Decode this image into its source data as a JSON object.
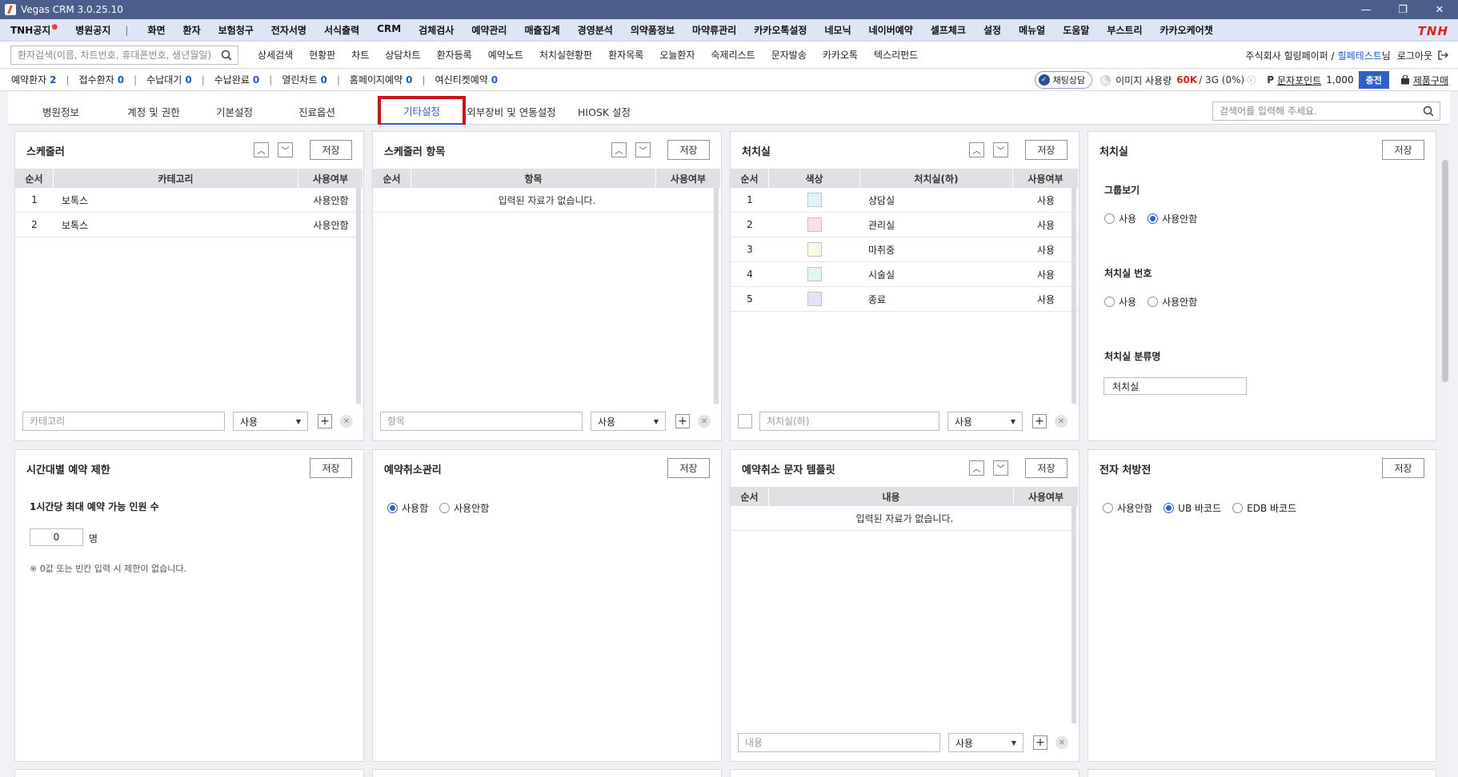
{
  "window": {
    "title": "Vegas CRM 3.0.25.10",
    "minimize": "—",
    "maximize": "❐",
    "close": "✕"
  },
  "menu": {
    "notice": "TNH공지",
    "notice_dot": "●",
    "hospital_notice": "병원공지",
    "sep": "|",
    "items": [
      "화면",
      "환자",
      "보험청구",
      "전자서명",
      "서식출력",
      "CRM",
      "검체검사",
      "예약관리",
      "매출집계",
      "경영분석",
      "의약품정보",
      "마약류관리",
      "카카오톡설정",
      "네모닉",
      "네이버예약",
      "셀프체크",
      "설정",
      "메뉴얼",
      "도움말",
      "부스트리",
      "카카오케어챗"
    ],
    "brand": "TNH"
  },
  "subbar": {
    "search_placeholder": "환자검색(이름, 차트번호, 휴대폰번호, 생년월일)",
    "links": [
      "상세검색",
      "현황판",
      "차트",
      "상담차트",
      "환자등록",
      "예약노트",
      "처치실현황판",
      "환자목록",
      "오늘환자",
      "숙제리스트",
      "문자발송",
      "카카오톡",
      "텍스리펀드"
    ],
    "company": "주식회사 힐링페이퍼 /",
    "user": "힐페테스트",
    "user_suffix": "님",
    "logout": "로그아웃"
  },
  "status": {
    "items": [
      {
        "label": "예약환자",
        "count": "2"
      },
      {
        "label": "접수환자",
        "count": "0"
      },
      {
        "label": "수납대기",
        "count": "0"
      },
      {
        "label": "수납완료",
        "count": "0"
      },
      {
        "label": "열린차트",
        "count": "0"
      },
      {
        "label": "홈페이지예약",
        "count": "0"
      },
      {
        "label": "여신티켓예약",
        "count": "0"
      }
    ],
    "chat": "채팅상담",
    "image_usage_label": "이미지 사용량",
    "image_usage_value": "60K",
    "image_usage_tail": "/ 3G (0%)",
    "point_label": "문자포인트",
    "point_value": "1,000",
    "charge": "충전",
    "buy": "제품구매"
  },
  "tabs": {
    "items": [
      "병원정보",
      "계정 및 권한",
      "기본설정",
      "진료옵션",
      "기타설정",
      "외부장비 및 연동설정",
      "HIOSK 설정"
    ],
    "active": "기타설정",
    "search_placeholder": "검색어를 입력해 주세요."
  },
  "common": {
    "save": "저장",
    "up": "︿",
    "down": "﹀",
    "plus": "+",
    "remove": "✕",
    "caret": "▼",
    "empty": "입력된 자료가 없습니다."
  },
  "scheduler": {
    "title": "스케줄러",
    "columns": [
      "순서",
      "카테고리",
      "사용여부"
    ],
    "rows": [
      {
        "order": "1",
        "category": "보톡스",
        "use": "사용안함"
      },
      {
        "order": "2",
        "category": "보톡스",
        "use": "사용안함"
      }
    ],
    "input_placeholder": "카테고리",
    "select_value": "사용"
  },
  "scheduler_items": {
    "title": "스케줄러 항목",
    "columns": [
      "순서",
      "항목",
      "사용여부"
    ],
    "input_placeholder": "항목",
    "select_value": "사용"
  },
  "treatment_room": {
    "title": "처치실",
    "columns": [
      "순서",
      "색상",
      "처치실(하)",
      "사용여부"
    ],
    "rows": [
      {
        "order": "1",
        "color": "#dff3fb",
        "name": "상담실",
        "use": "사용"
      },
      {
        "order": "2",
        "color": "#fde0e0",
        "name": "관리실",
        "use": "사용"
      },
      {
        "order": "3",
        "color": "#f3fbe0",
        "name": "마취중",
        "use": "사용"
      },
      {
        "order": "4",
        "color": "#e0f7e5",
        "name": "시술실",
        "use": "사용"
      },
      {
        "order": "5",
        "color": "#e4e3f7",
        "name": "종료",
        "use": "사용"
      }
    ],
    "input_placeholder": "처치실(하)",
    "select_value": "사용"
  },
  "room_settings": {
    "title": "처치실",
    "group_label": "그룹보기",
    "group_options": [
      "사용",
      "사용안함"
    ],
    "group_selected": 1,
    "number_label": "처치실 번호",
    "number_options": [
      "사용",
      "사용안함"
    ],
    "number_selected": -1,
    "category_label": "처치실 분류명",
    "category_value": "처치실"
  },
  "time_limit": {
    "title": "시간대별 예약 제한",
    "label": "1시간당 최대 예약 가능 인원 수",
    "value": "0",
    "unit": "명",
    "note": "※ 0값 또는 빈칸 입력 시 제한이 없습니다."
  },
  "cancel_mgmt": {
    "title": "예약취소관리",
    "options": [
      "사용함",
      "사용안함"
    ],
    "selected": 0
  },
  "cancel_sms": {
    "title": "예약취소 문자 템플릿",
    "columns": [
      "순서",
      "내용",
      "사용여부"
    ],
    "input_placeholder": "내용",
    "select_value": "사용"
  },
  "e_prescription": {
    "title": "전자 처방전",
    "options": [
      "사용안함",
      "UB 바코드",
      "EDB 바코드"
    ],
    "selected": 1
  }
}
